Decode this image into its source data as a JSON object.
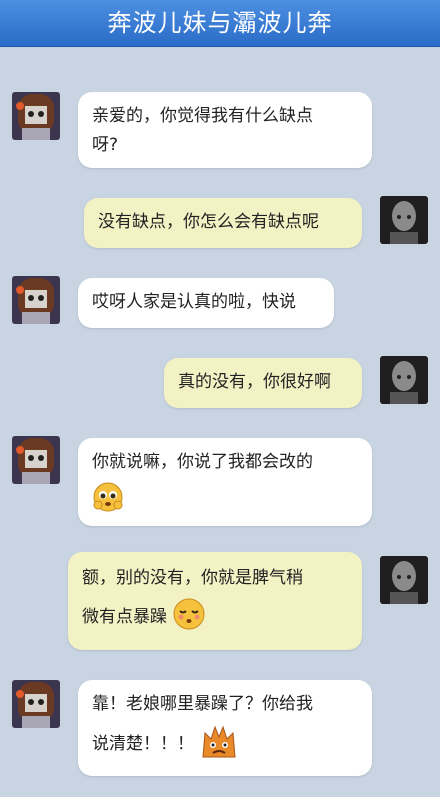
{
  "header": {
    "title": "奔波儿妹与灞波儿奔"
  },
  "messages": [
    {
      "side": "left",
      "text1": "亲爱的，你觉得我有什么缺点",
      "text2": "呀?"
    },
    {
      "side": "right",
      "text1": "没有缺点，你怎么会有缺点呢"
    },
    {
      "side": "left",
      "text1": "哎呀人家是认真的啦，快说"
    },
    {
      "side": "right",
      "text1": "真的没有，你很好啊"
    },
    {
      "side": "left",
      "text1": "你就说嘛，你说了我都会改的",
      "emoji": "pleading-face-emoji"
    },
    {
      "side": "right",
      "text1": "额，别的没有，你就是脾气稍",
      "text2": "微有点暴躁",
      "emoji": "kissing-face-emoji"
    },
    {
      "side": "left",
      "text1": "靠！老娘哪里暴躁了？你给我",
      "text2": "说清楚！！！",
      "emoji": "angry-emoji"
    }
  ],
  "colors": {
    "left_bubble": "#ffffff",
    "right_bubble": "#f3f2c5",
    "background": "#c8d4e2",
    "header": "#2a6cc8"
  }
}
